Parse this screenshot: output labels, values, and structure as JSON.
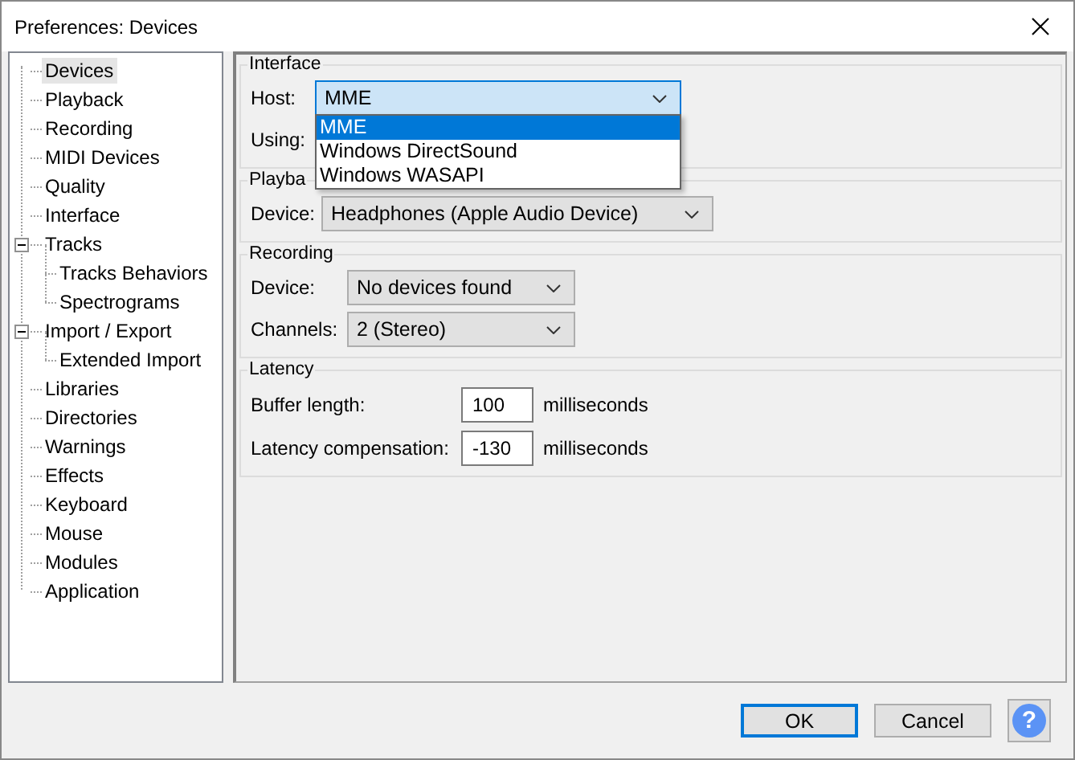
{
  "window": {
    "title": "Preferences: Devices"
  },
  "tree": [
    {
      "label": "Devices",
      "selected": true
    },
    {
      "label": "Playback",
      "selected": false
    },
    {
      "label": "Recording",
      "selected": false
    },
    {
      "label": "MIDI Devices",
      "selected": false
    },
    {
      "label": "Quality",
      "selected": false
    },
    {
      "label": "Interface",
      "selected": false
    },
    {
      "label": "Tracks",
      "selected": false,
      "expanded": true,
      "children": [
        {
          "label": "Tracks Behaviors",
          "selected": false
        },
        {
          "label": "Spectrograms",
          "selected": false
        }
      ]
    },
    {
      "label": "Import / Export",
      "selected": false,
      "expanded": true,
      "children": [
        {
          "label": "Extended Import",
          "selected": false
        }
      ]
    },
    {
      "label": "Libraries",
      "selected": false
    },
    {
      "label": "Directories",
      "selected": false
    },
    {
      "label": "Warnings",
      "selected": false
    },
    {
      "label": "Effects",
      "selected": false
    },
    {
      "label": "Keyboard",
      "selected": false
    },
    {
      "label": "Mouse",
      "selected": false
    },
    {
      "label": "Modules",
      "selected": false
    },
    {
      "label": "Application",
      "selected": false
    }
  ],
  "interface": {
    "title": "Interface",
    "host_label": "Host:",
    "host_value": "MME",
    "using_label": "Using:",
    "host_options": [
      {
        "label": "MME",
        "selected": true
      },
      {
        "label": "Windows DirectSound",
        "selected": false
      },
      {
        "label": "Windows WASAPI",
        "selected": false
      }
    ]
  },
  "playback": {
    "title": "Playba",
    "device_label": "Device:",
    "device_value": "Headphones (Apple Audio Device)"
  },
  "recording": {
    "title": "Recording",
    "device_label": "Device:",
    "device_value": "No devices found",
    "channels_label": "Channels:",
    "channels_value": "2 (Stereo)"
  },
  "latency": {
    "title": "Latency",
    "rows": [
      {
        "label": "Buffer length:",
        "value": "100",
        "unit": "milliseconds"
      },
      {
        "label": "Latency compensation:",
        "value": "-130",
        "unit": "milliseconds"
      }
    ]
  },
  "buttons": [
    {
      "label": "OK",
      "default": true
    },
    {
      "label": "Cancel",
      "default": false
    }
  ],
  "help": "?"
}
